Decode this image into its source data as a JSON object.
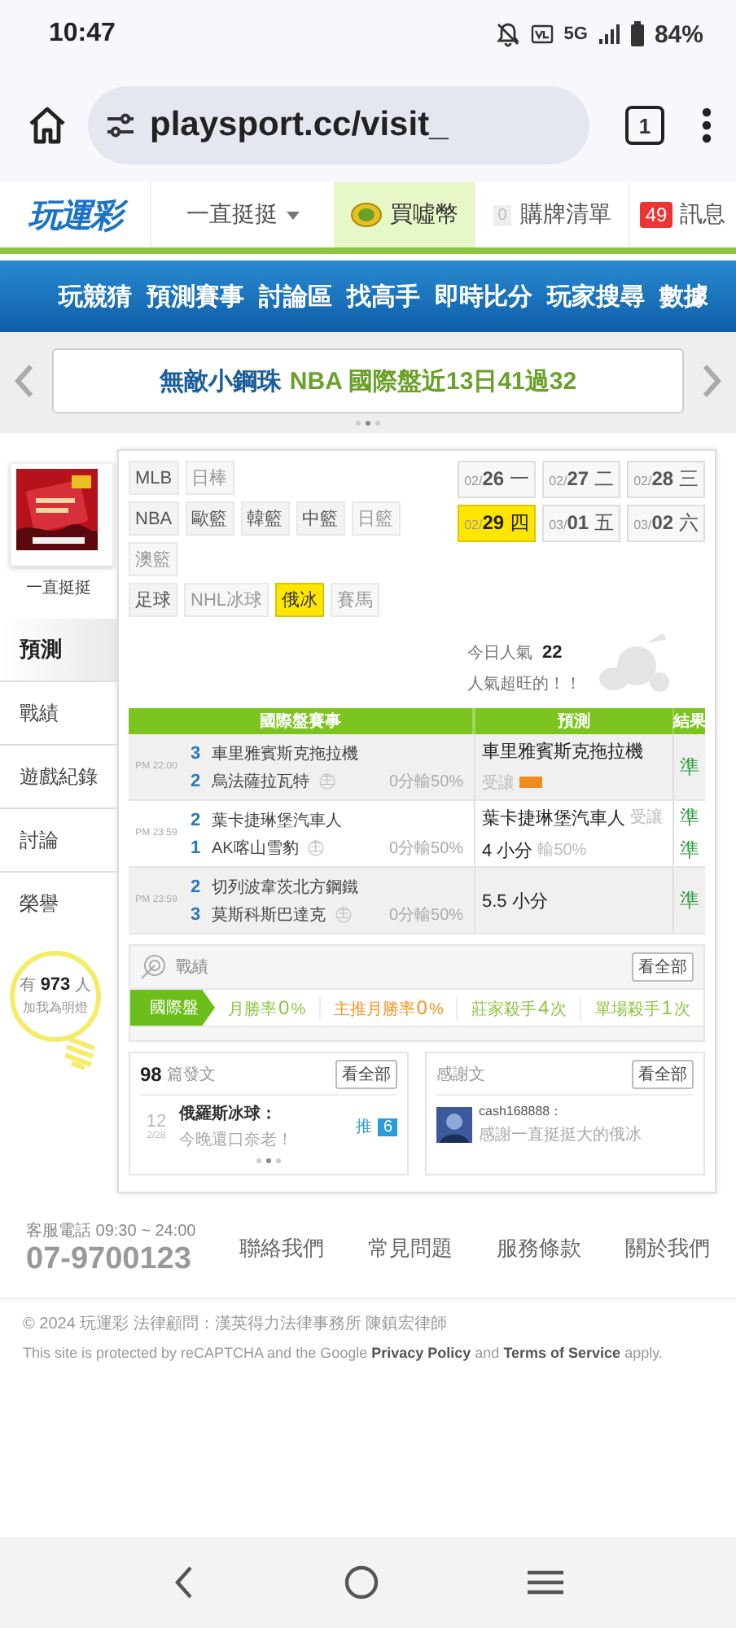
{
  "status_bar": {
    "time": "10:47",
    "network": "5G",
    "battery": "84%"
  },
  "browser": {
    "url": "playsport.cc/visit_",
    "tab_count": "1"
  },
  "site_header": {
    "logo": "玩運彩",
    "user": "一直挺挺",
    "coin_label": "買噓幣",
    "cart_count": "0",
    "cart_label": "購牌清單",
    "message_count": "49",
    "message_label": "訊息"
  },
  "nav": [
    "玩競猜",
    "預測賽事",
    "討論區",
    "找高手",
    "即時比分",
    "玩家搜尋",
    "數據"
  ],
  "banner": {
    "name": "無敵小鋼珠",
    "text": "NBA 國際盤近13日41過32"
  },
  "profile": {
    "name": "一直挺挺",
    "menu": [
      {
        "label": "預測",
        "selected": true
      },
      {
        "label": "戰績",
        "selected": false
      },
      {
        "label": "遊戲紀錄",
        "selected": false
      },
      {
        "label": "討論",
        "selected": false
      },
      {
        "label": "榮譽",
        "selected": false
      }
    ],
    "fans": "有 **973** 人",
    "fans_note": "加我為明燈"
  },
  "sports": [
    {
      "tags": [
        {
          "label": "MLB",
          "selected": false,
          "disabled": false
        },
        {
          "label": "日棒",
          "selected": false,
          "disabled": true
        }
      ]
    },
    {
      "tags": [
        {
          "label": "NBA",
          "selected": false,
          "disabled": false
        },
        {
          "label": "歐籃",
          "selected": false,
          "disabled": false
        },
        {
          "label": "韓籃",
          "selected": false,
          "disabled": false
        },
        {
          "label": "中籃",
          "selected": false,
          "disabled": false
        },
        {
          "label": "日籃",
          "selected": false,
          "disabled": true
        },
        {
          "label": "澳籃",
          "selected": false,
          "disabled": true
        }
      ]
    },
    {
      "tags": [
        {
          "label": "足球",
          "selected": false,
          "disabled": false
        },
        {
          "label": "NHL冰球",
          "selected": false,
          "disabled": true
        },
        {
          "label": "俄冰",
          "selected": true,
          "disabled": false
        },
        {
          "label": "賽馬",
          "selected": false,
          "disabled": true
        }
      ]
    }
  ],
  "dates": [
    {
      "month": "02/",
      "day": "26",
      "weekday": "一",
      "selected": false
    },
    {
      "month": "02/",
      "day": "27",
      "weekday": "二",
      "selected": false
    },
    {
      "month": "02/",
      "day": "28",
      "weekday": "三",
      "selected": false
    },
    {
      "month": "02/",
      "day": "29",
      "weekday": "四",
      "selected": true
    },
    {
      "month": "03/",
      "day": "01",
      "weekday": "五",
      "selected": false
    },
    {
      "month": "03/",
      "day": "02",
      "weekday": "六",
      "selected": false
    }
  ],
  "popularity": {
    "label": "今日人氣",
    "value": "22",
    "note": "人氣超旺的！！"
  },
  "table": {
    "columns": [
      "國際盤賽事",
      "預測",
      "結果"
    ],
    "rows": [
      {
        "time": "PM 22:00",
        "teams": [
          {
            "score": "3",
            "name": "車里雅賓斯克拖拉機"
          },
          {
            "score": "2",
            "name": "烏法薩拉瓦特",
            "home": "主"
          }
        ],
        "line": "0分輸50%",
        "picks": [
          {
            "text": "車里雅賓斯克拖拉機",
            "note": "受讓",
            "badge": true,
            "result": "準"
          }
        ]
      },
      {
        "time": "PM 23:59",
        "teams": [
          {
            "score": "2",
            "name": "葉卡捷琳堡汽車人"
          },
          {
            "score": "1",
            "name": "AK喀山雪豹",
            "home": "主"
          }
        ],
        "line": "0分輸50%",
        "picks": [
          {
            "text": "葉卡捷琳堡汽車人",
            "note": "受讓",
            "badge": false,
            "result": "準"
          },
          {
            "text": "4 小分",
            "note": "輸50%",
            "badge": false,
            "result": "準"
          }
        ]
      },
      {
        "time": "PM 23:59",
        "teams": [
          {
            "score": "2",
            "name": "切列波韋茨北方鋼鐵"
          },
          {
            "score": "3",
            "name": "莫斯科斯巴達克",
            "home": "主"
          }
        ],
        "line": "0分輸50%",
        "picks": [
          {
            "text": "5.5 小分",
            "badge": false,
            "result": "準"
          }
        ]
      }
    ]
  },
  "stats": {
    "title": "戰績",
    "more": "看全部",
    "tab": "國際盤",
    "items": [
      {
        "label": "月勝率",
        "value": "0",
        "unit": "%",
        "color": "#8cc63f"
      },
      {
        "label": "主推月勝率",
        "value": "0",
        "unit": "%",
        "color": "#f7931e"
      },
      {
        "label": "莊家殺手",
        "value": "4",
        "unit": "次",
        "color": "#8cc63f"
      },
      {
        "label": "單場殺手",
        "value": "1",
        "unit": "次",
        "color": "#8cc63f"
      }
    ]
  },
  "posts": {
    "count": "98",
    "label": "篇發文",
    "more": "看全部",
    "items": [
      {
        "number": "12",
        "date": "2/28",
        "title": "俄羅斯冰球：",
        "excerpt": "今晚還口奈老！",
        "tag": "推",
        "tag_count": "6"
      }
    ]
  },
  "thanks": {
    "title": "感謝文",
    "more": "看全部",
    "items": [
      {
        "user": "cash168888：",
        "text": "感謝一直挺挺大的俄冰"
      }
    ]
  },
  "footer": {
    "hotline": "客服電話 09:30 ~ 24:00",
    "phone": "07-9700123",
    "links": [
      "聯絡我們",
      "常見問題",
      "服務條款",
      "關於我們"
    ],
    "copyright": "© 2024 玩運彩 法律顧問：漢英得力法律事務所 陳鎮宏律師",
    "recaptcha": "This site is protected by reCAPTCHA and the Google **Privacy Policy** and **Terms of Service** apply."
  }
}
